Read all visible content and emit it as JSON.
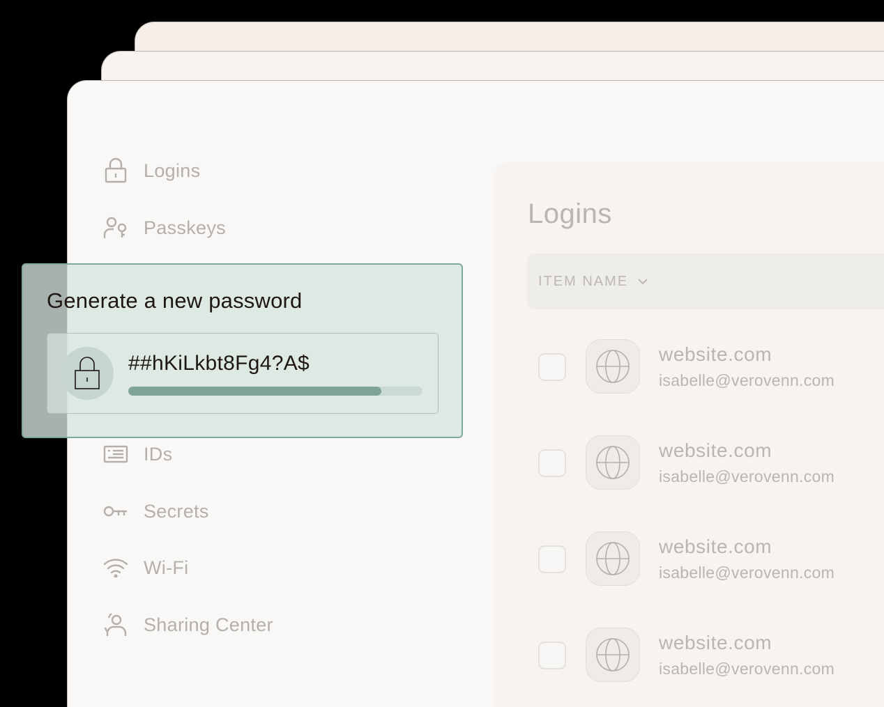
{
  "sidebar": {
    "items": [
      {
        "label": "Logins",
        "icon": "lock-icon"
      },
      {
        "label": "Passkeys",
        "icon": "passkey-person-icon"
      },
      {
        "label": "IDs",
        "icon": "id-card-icon"
      },
      {
        "label": "Secrets",
        "icon": "key-icon"
      },
      {
        "label": "Wi-Fi",
        "icon": "wifi-icon"
      },
      {
        "label": "Sharing Center",
        "icon": "sharing-person-icon"
      }
    ]
  },
  "panel": {
    "title": "Logins",
    "column_header": "ITEM NAME",
    "rows": [
      {
        "site": "website.com",
        "email": "isabelle@verovenn.com"
      },
      {
        "site": "website.com",
        "email": "isabelle@verovenn.com"
      },
      {
        "site": "website.com",
        "email": "isabelle@verovenn.com"
      },
      {
        "site": "website.com",
        "email": "isabelle@verovenn.com"
      }
    ]
  },
  "generator": {
    "title": "Generate a new password",
    "password": "##hKiLkbt8Fg4?A$",
    "strength_fraction": 0.86
  },
  "colors": {
    "accent": "#7fa396",
    "card_border": "#7fa89d",
    "muted_text": "#b3afab"
  }
}
